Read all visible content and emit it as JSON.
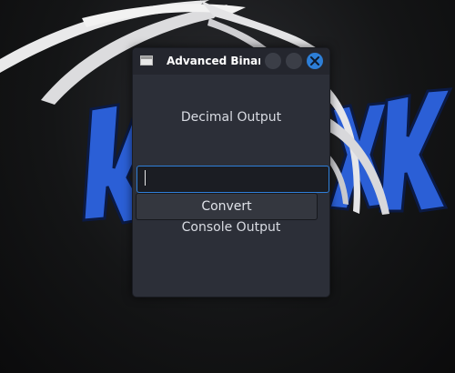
{
  "window": {
    "title": "Advanced Binary C",
    "decimal_output": "Decimal Output",
    "input": {
      "value": "",
      "placeholder": ""
    },
    "convert_label": "Convert",
    "console_output": "Console Output",
    "buttons": [
      "minimize",
      "maximize",
      "close"
    ]
  },
  "colors": {
    "window_bg": "#2c2f38",
    "titlebar_bg": "#24262e",
    "accent": "#2d7ed6",
    "wallpaper_blue": "#2b5fd6"
  },
  "icons": {
    "app": "window-icon",
    "close": "close-icon",
    "wallpaper_logo": "kali-dragon-logo"
  }
}
